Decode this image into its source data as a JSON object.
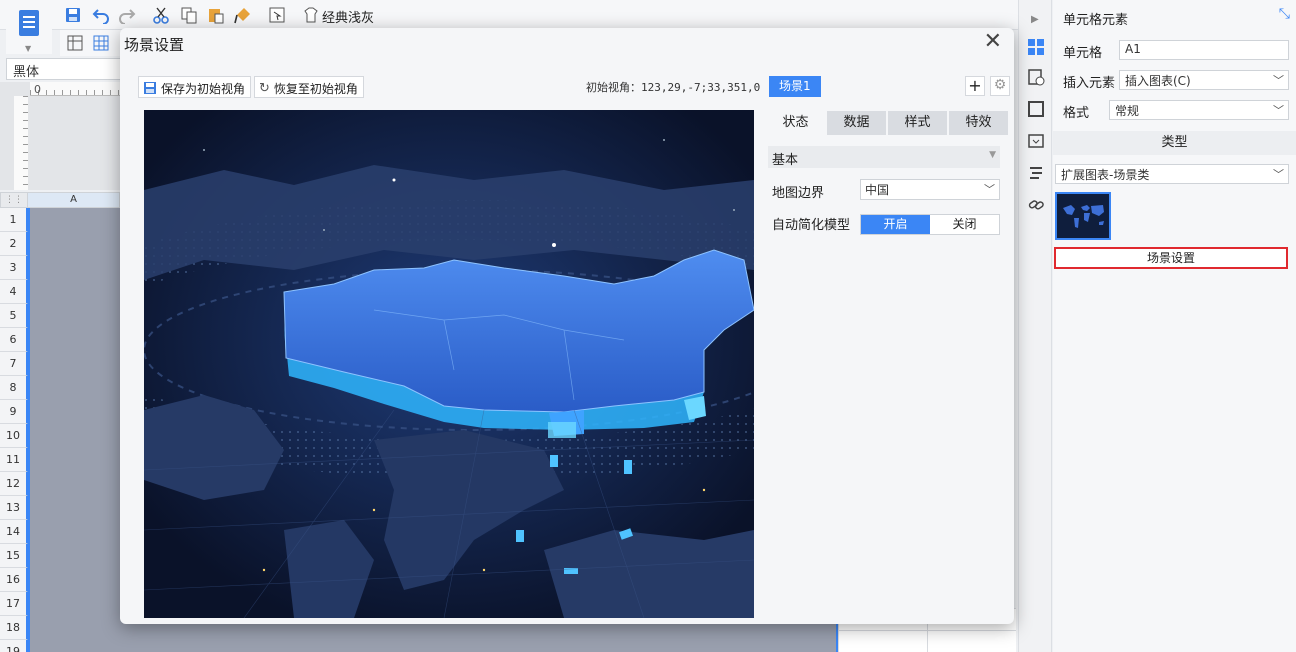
{
  "toolbar": {
    "theme_label": "经典浅灰",
    "font_value": "黑体"
  },
  "sheet": {
    "column_a": "A",
    "rows": [
      "1",
      "2",
      "3",
      "4",
      "5",
      "6",
      "7",
      "8",
      "9",
      "10",
      "11",
      "12",
      "13",
      "14",
      "15",
      "16",
      "17",
      "18",
      "19"
    ],
    "ruler_zero": "0"
  },
  "props": {
    "title": "单元格元素",
    "cell_label": "单元格",
    "cell_value": "A1",
    "insert_label": "插入元素",
    "insert_value": "插入图表(C)",
    "format_label": "格式",
    "format_value": "常规",
    "type_header": "类型",
    "type_value": "扩展图表-场景类",
    "scene_button": "场景设置"
  },
  "modal": {
    "title": "场景设置",
    "save_btn": "保存为初始视角",
    "restore_btn": "恢复至初始视角",
    "viewpoint": "初始视角：123,29,-7;33,351,0",
    "scene_tag": "场景1",
    "tabs": [
      "状态",
      "数据",
      "样式",
      "特效"
    ],
    "section": "基本",
    "map_boundary_label": "地图边界",
    "map_boundary_value": "中国",
    "simplify_label": "自动简化模型",
    "toggle_on": "开启",
    "toggle_off": "关闭"
  },
  "colors": {
    "accent": "#3b86f5",
    "map_bg": "#0b1630",
    "highlight_border": "#e0292f"
  }
}
